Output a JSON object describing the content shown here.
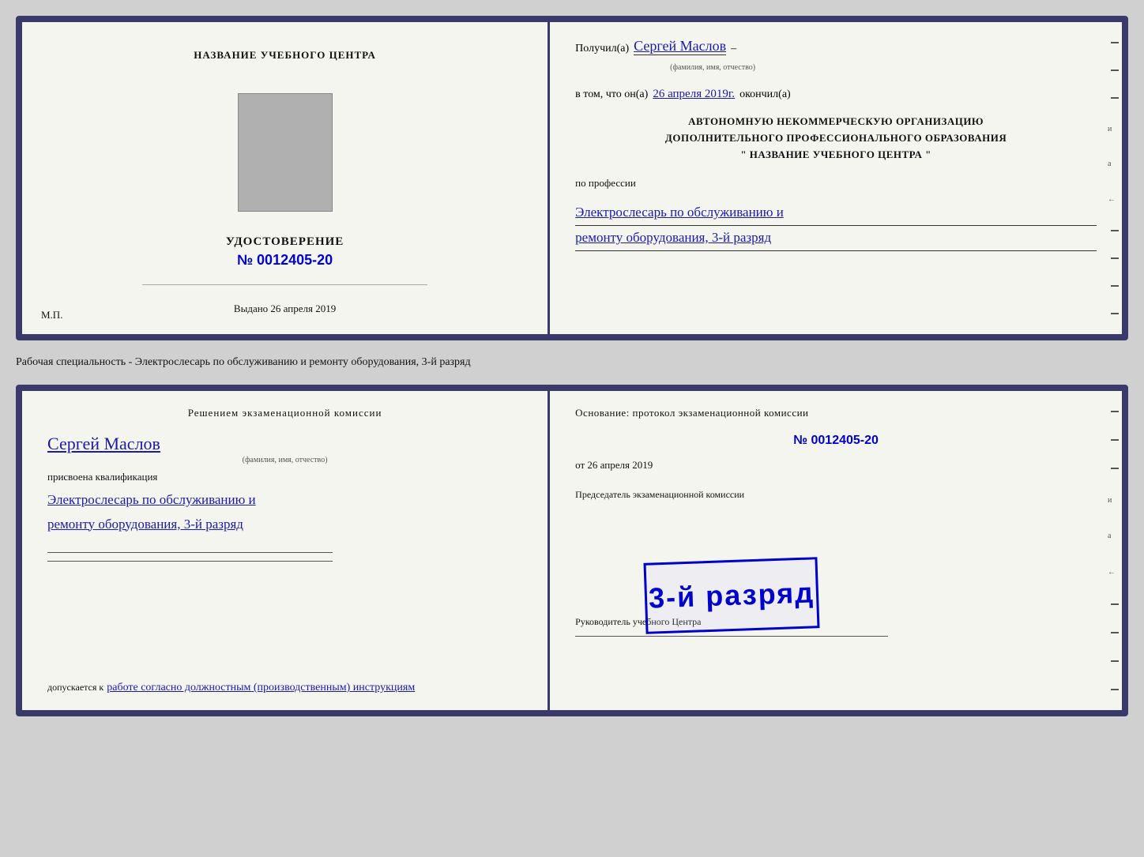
{
  "topCard": {
    "left": {
      "orgTitle": "НАЗВАНИЕ УЧЕБНОГО ЦЕНТРА",
      "documentTitle": "УДОСТОВЕРЕНИЕ",
      "number": "№ 0012405-20",
      "vydanoLabel": "Выдано",
      "vydanoDate": "26 апреля 2019",
      "mpLabel": "М.П."
    },
    "right": {
      "poluchilLabel": "Получил(а)",
      "recipientName": "Сергей Маслов",
      "fioSubtitle": "(фамилия, имя, отчество)",
      "dashSymbol": "–",
      "vtomLabel": "в том, что он(а)",
      "date": "26 апреля 2019г.",
      "okonchilLabel": "окончил(а)",
      "orgBlock1": "АВТОНОМНУЮ НЕКОММЕРЧЕСКУЮ ОРГАНИЗАЦИЮ",
      "orgBlock2": "ДОПОЛНИТЕЛЬНОГО ПРОФЕССИОНАЛЬНОГО ОБРАЗОВАНИЯ",
      "orgBlock3": "\" НАЗВАНИЕ УЧЕБНОГО ЦЕНТРА \"",
      "poProfessiiLabel": "по профессии",
      "profession1": "Электрослесарь по обслуживанию и",
      "profession2": "ремонту оборудования, 3-й разряд"
    }
  },
  "specialtyLabel": "Рабочая специальность - Электрослесарь по обслуживанию и ремонту оборудования, 3-й разряд",
  "bottomCard": {
    "left": {
      "resheniemText": "Решением  экзаменационной  комиссии",
      "recipientName": "Сергей Маслов",
      "fioSubtitle": "(фамилия, имя, отчество)",
      "prisvoenaMark": "присвоена квалификация",
      "qualification1": "Электрослесарь по обслуживанию и",
      "qualification2": "ремонту оборудования, 3-й разряд",
      "dopuskaetsyaLabel": "допускается к",
      "dopuskaetsyaValue": "работе согласно должностным (производственным) инструкциям"
    },
    "right": {
      "osnovanieLabel": "Основание: протокол экзаменационной  комиссии",
      "protocolNumber": "№  0012405-20",
      "otLabel": "от",
      "protocolDate": "26 апреля 2019",
      "predsedatelLabel": "Председатель экзаменационной комиссии",
      "stampText": "3-й разряд",
      "rukovoditelLabel": "Руководитель учебного Центра"
    }
  },
  "edgeMarks": [
    "–",
    "–",
    "–",
    "и",
    "а",
    "←",
    "–",
    "–",
    "–",
    "–"
  ]
}
